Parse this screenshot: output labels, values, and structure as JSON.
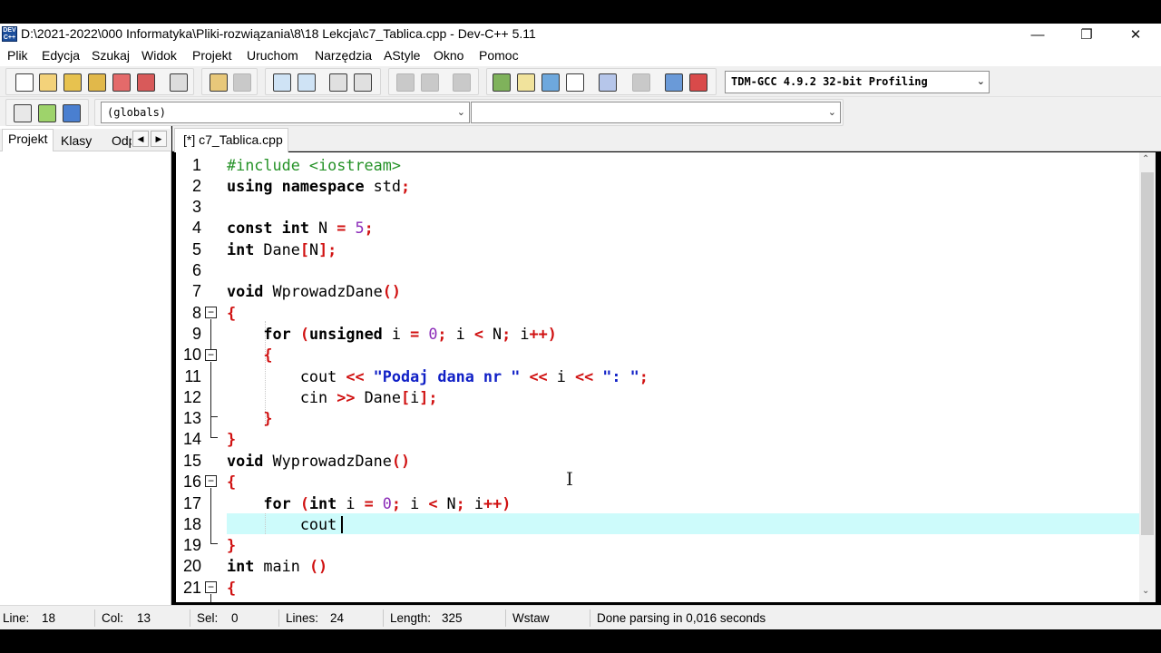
{
  "window": {
    "title": "D:\\2021-2022\\000 Informatyka\\Pliki-rozwiązania\\8\\18 Lekcja\\c7_Tablica.cpp - Dev-C++ 5.11",
    "app_icon_text": "DEV\nC++",
    "minimize": "—",
    "restore": "❐",
    "close": "✕"
  },
  "menu": [
    "Plik",
    "Edycja",
    "Szukaj",
    "Widok",
    "Projekt",
    "Uruchom",
    "Narzędzia",
    "AStyle",
    "Okno",
    "Pomoc"
  ],
  "toolbar": {
    "compiler": "TDM-GCC 4.9.2 32-bit Profiling",
    "scope": "(globals)",
    "member": "",
    "icons": [
      "new-file-icon",
      "open-file-icon",
      "save-icon",
      "save-all-icon",
      "close-file-icon",
      "close-all-icon",
      "print-icon",
      "undo-icon",
      "redo-icon",
      "find-icon",
      "replace-icon",
      "indent-icon",
      "unindent-icon",
      "compile-icon",
      "run-icon",
      "compile-run-icon",
      "rebuild-icon",
      "new-project-icon",
      "project-options-icon",
      "class-icon",
      "layout-icon",
      "check-icon",
      "stop-icon",
      "chart-icon",
      "bug-icon",
      "goto-icon",
      "add-icon",
      "bookmark-icon"
    ]
  },
  "left_panel": {
    "tabs": [
      "Projekt",
      "Klasy",
      "Odp"
    ],
    "scroll_left": "◀",
    "scroll_right": "▶"
  },
  "editor": {
    "tab_label": "[*] c7_Tablica.cpp",
    "current_line": 18,
    "lines": [
      "1",
      "2",
      "3",
      "4",
      "5",
      "6",
      "7",
      "8",
      "9",
      "10",
      "11",
      "12",
      "13",
      "14",
      "15",
      "16",
      "17",
      "18",
      "19",
      "20",
      "21"
    ]
  },
  "status": {
    "line_label": "Line:",
    "line_value": "18",
    "col_label": "Col:",
    "col_value": "13",
    "sel_label": "Sel:",
    "sel_value": "0",
    "lines_label": "Lines:",
    "lines_value": "24",
    "length_label": "Length:",
    "length_value": "325",
    "mode": "Wstaw",
    "message": "Done parsing in 0,016 seconds"
  }
}
